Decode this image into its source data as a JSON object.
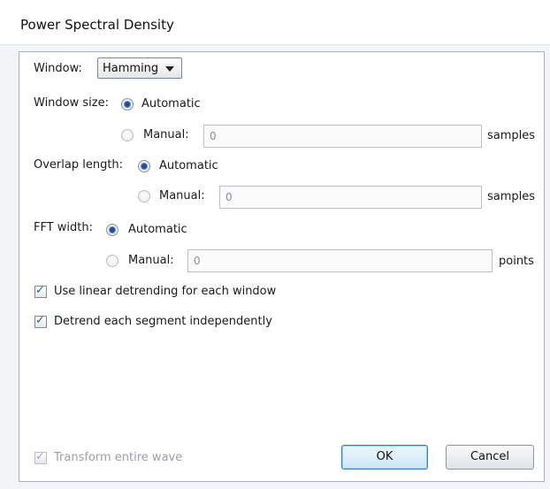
{
  "dialog": {
    "title": "Power Spectral Density"
  },
  "window": {
    "label": "Window:",
    "selected": "Hamming"
  },
  "window_size": {
    "label": "Window size:",
    "automatic_label": "Automatic",
    "manual_label": "Manual:",
    "value": "0",
    "unit": "samples",
    "selected": "automatic"
  },
  "overlap_length": {
    "label": "Overlap length:",
    "automatic_label": "Automatic",
    "manual_label": "Manual:",
    "value": "0",
    "unit": "samples",
    "selected": "automatic"
  },
  "fft_width": {
    "label": "FFT width:",
    "automatic_label": "Automatic",
    "manual_label": "Manual:",
    "value": "0",
    "unit": "points",
    "selected": "automatic"
  },
  "options": {
    "linear_detrending_label": "Use linear detrending for each window",
    "linear_detrending_checked": true,
    "detrend_segment_label": "Detrend each segment independently",
    "detrend_segment_checked": true,
    "transform_entire_label": "Transform entire wave",
    "transform_entire_checked": true,
    "transform_entire_enabled": false
  },
  "buttons": {
    "ok_label": "OK",
    "cancel_label": "Cancel"
  },
  "icons": {
    "dropdown": "chevron-down-icon",
    "checkmark": "check-icon"
  }
}
